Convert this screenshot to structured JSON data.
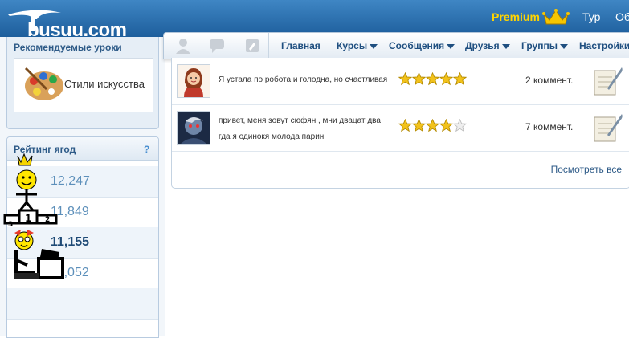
{
  "header": {
    "logo": "busuu.com",
    "premium_label": "Premium",
    "links": [
      "Тур",
      "Об"
    ]
  },
  "nav": {
    "items": [
      "Главная",
      "Курсы",
      "Сообщения",
      "Друзья",
      "Группы",
      "Настройки"
    ]
  },
  "sidebar": {
    "recommended": {
      "title": "Рекомендуемые уроки",
      "lesson_label": "Стили искусства"
    },
    "ranking": {
      "title": "Рейтинг ягод",
      "help": "?",
      "scores": [
        "12,247",
        "11,849",
        "11,155",
        "11,052"
      ]
    }
  },
  "posts": [
    {
      "text": "Я устала по робота и голодна, но счастливая",
      "rating": 5,
      "comments": "2 коммент."
    },
    {
      "text": "привет, меня зовут сюфян , мни двацат два гда я одинокя молода парин",
      "rating": 4,
      "comments": "7 коммент."
    }
  ],
  "see_all": "Посмотреть все",
  "colors": {
    "header": "#2a6fb0",
    "premium": "#ffd400",
    "nav_text": "#1f4f80",
    "star": "#f2c21b"
  }
}
